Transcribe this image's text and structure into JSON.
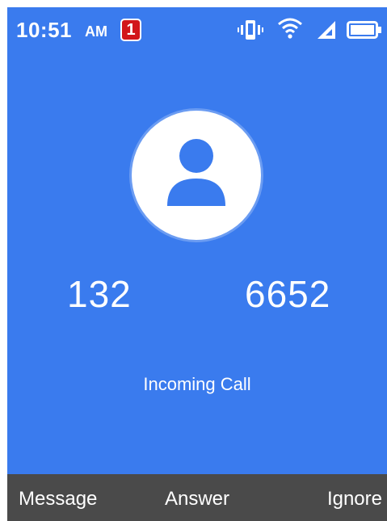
{
  "status_bar": {
    "time": "10:51",
    "ampm": "AM",
    "notification_count": "1",
    "icons": [
      "vibrate-icon",
      "wifi-icon",
      "cellular-signal-icon",
      "battery-icon"
    ]
  },
  "call": {
    "number_part_1": "132",
    "number_part_2": "6652",
    "status": "Incoming Call",
    "avatar_icon": "person-icon"
  },
  "softkeys": {
    "left": "Message",
    "center": "Answer",
    "right": "Ignore"
  },
  "colors": {
    "background": "#3a7bee",
    "softkey_bar": "#4a4a4a",
    "badge": "#d2161a",
    "text": "#ffffff"
  }
}
